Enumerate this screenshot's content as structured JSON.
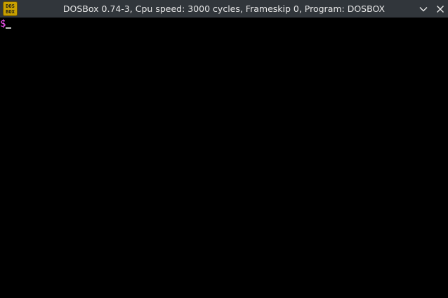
{
  "window": {
    "title": "DOSBox 0.74-3, Cpu speed: 3000 cycles, Frameskip 0, Program: DOSBOX",
    "icon_name": "dosbox-logo-icon",
    "icon_text_top": "DOS",
    "icon_text_bottom": "BOX",
    "buttons": {
      "minimize_icon": "chevron-down-icon",
      "close_icon": "close-icon"
    }
  },
  "terminal": {
    "prompt": "$",
    "prompt_color": "#ff55ff",
    "background": "#000000"
  },
  "colors": {
    "titlebar": "#31363b",
    "title_text": "#e8e8e8",
    "icon_bg": "#c8a000",
    "icon_text": "#1a1a1a"
  }
}
